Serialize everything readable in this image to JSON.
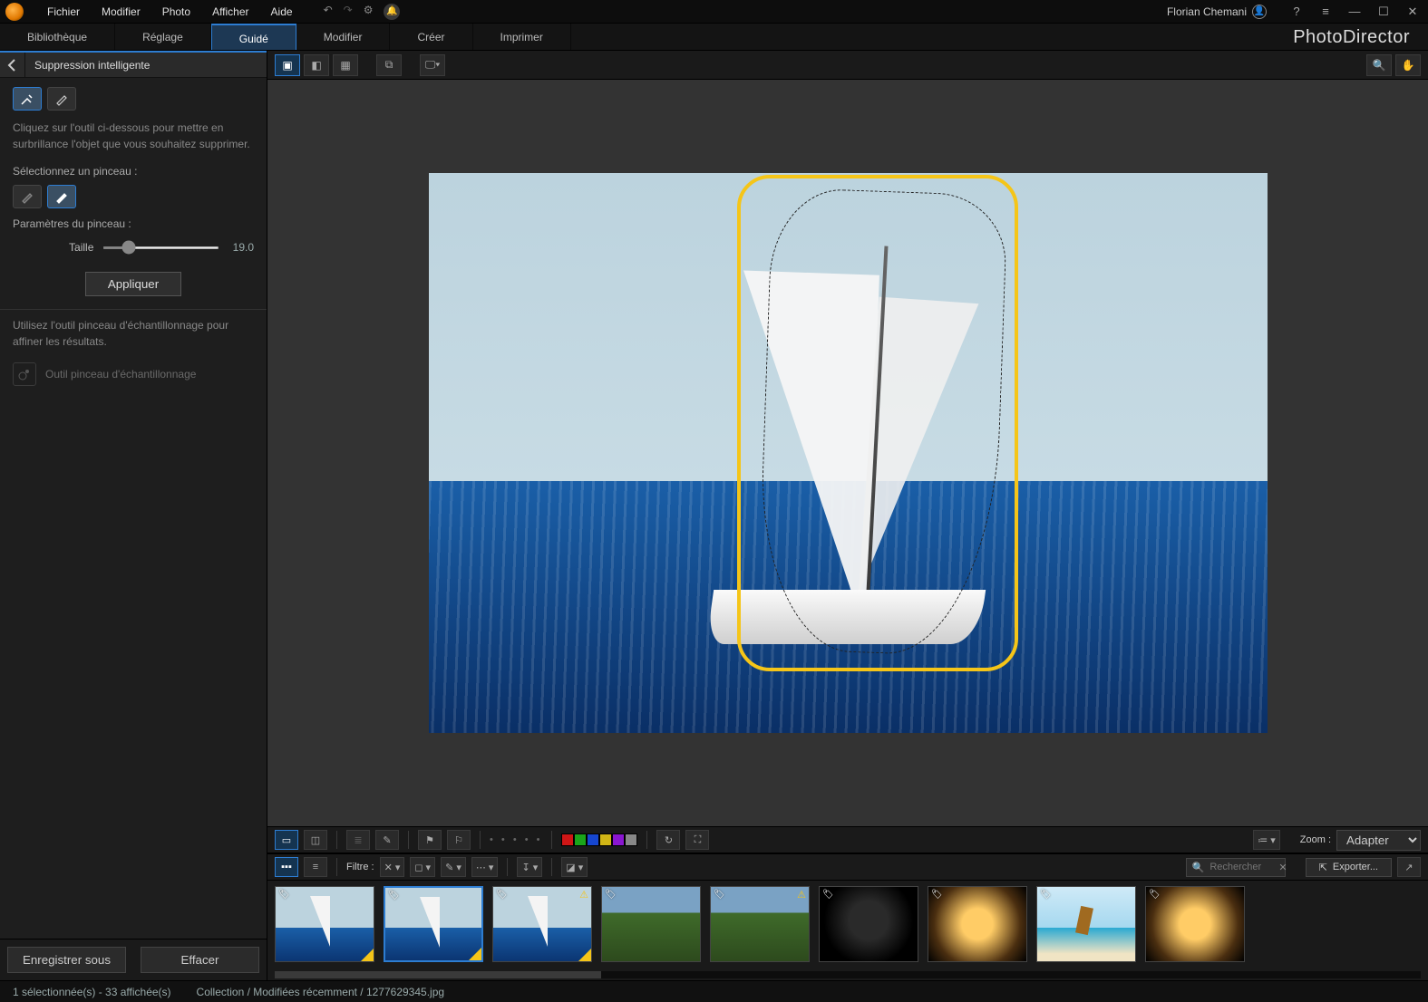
{
  "menubar": [
    "Fichier",
    "Modifier",
    "Photo",
    "Afficher",
    "Aide"
  ],
  "user": "Florian Chemani",
  "brand": "PhotoDirector",
  "tabs": [
    "Bibliothèque",
    "Réglage",
    "Guidé",
    "Modifier",
    "Créer",
    "Imprimer"
  ],
  "tabs_active": 2,
  "panel": {
    "title": "Suppression intelligente",
    "help1": "Cliquez sur l'outil ci-dessous pour mettre en surbrillance l'objet que vous souhaitez supprimer.",
    "sel_brush_label": "Sélectionnez un pinceau :",
    "params_label": "Paramètres du pinceau :",
    "size_label": "Taille",
    "size_value": "19.0",
    "apply": "Appliquer",
    "help2": "Utilisez l'outil pinceau d'échantillonnage pour affiner les résultats.",
    "sampling_tool": "Outil pinceau d'échantillonnage",
    "save_as": "Enregistrer sous",
    "clear": "Effacer"
  },
  "lowbar": {
    "zoom_label": "Zoom :",
    "zoom_value": "Adapter",
    "filter_label": "Filtre :",
    "search_placeholder": "Rechercher",
    "export": "Exporter..."
  },
  "colors": [
    "#d01616",
    "#1aa51a",
    "#1646d0",
    "#d0b516",
    "#8a16d0",
    "#888888"
  ],
  "thumbs": [
    {
      "kind": "boat",
      "sel": false,
      "flag": true,
      "corner": true
    },
    {
      "kind": "boat",
      "sel": true,
      "flag": true,
      "corner": true
    },
    {
      "kind": "boat",
      "sel": false,
      "flag": true,
      "corner": true,
      "warn": true
    },
    {
      "kind": "road",
      "sel": false,
      "flag": true
    },
    {
      "kind": "road",
      "sel": false,
      "flag": true,
      "warn": true
    },
    {
      "kind": "dark",
      "sel": false,
      "flag": true
    },
    {
      "kind": "room",
      "sel": false,
      "flag": true
    },
    {
      "kind": "beach",
      "sel": false,
      "flag": true
    },
    {
      "kind": "room",
      "sel": false,
      "flag": true
    }
  ],
  "status": {
    "sel": "1 sélectionnée(s) - 33 affichée(s)",
    "path": "Collection / Modifiées récemment / 1277629345.jpg"
  }
}
